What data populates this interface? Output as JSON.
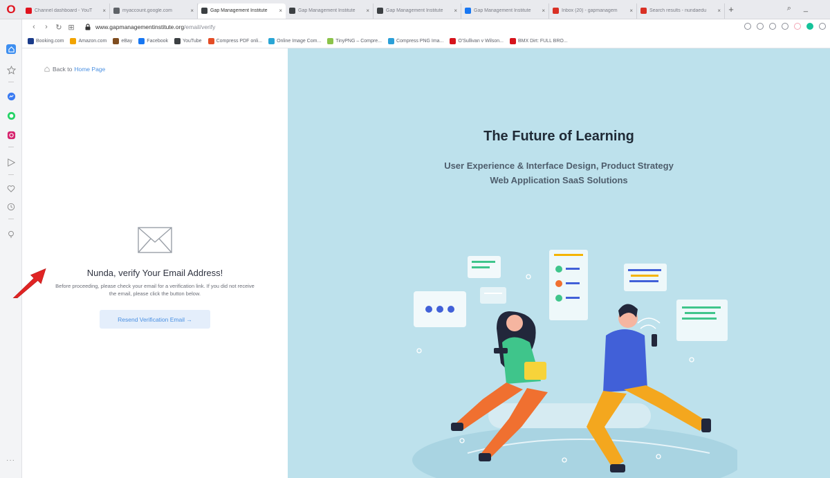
{
  "browser": {
    "tabs": [
      {
        "label": "Channel dashboard - YouT",
        "fav": "#e0131e",
        "active": false
      },
      {
        "label": "myaccount.google.com",
        "fav": "#5f6368",
        "active": false
      },
      {
        "label": "Gap Management Institute",
        "fav": "#3c4043",
        "active": true
      },
      {
        "label": "Gap Management Institute",
        "fav": "#3c4043",
        "active": false
      },
      {
        "label": "Gap Management Institute",
        "fav": "#3c4043",
        "active": false
      },
      {
        "label": "Gap Management Institute",
        "fav": "#1877f2",
        "active": false
      },
      {
        "label": "Inbox (20) - gapmanagem",
        "fav": "#d93025",
        "active": false
      },
      {
        "label": "Search results - nundaedu",
        "fav": "#d93025",
        "active": false
      }
    ],
    "address": {
      "host": "www.gapmanagementinstitute.org",
      "path": "/email/verify"
    },
    "bookmarks": [
      {
        "label": "Booking.com",
        "fav": "#1a3b8a"
      },
      {
        "label": "Amazon.com",
        "fav": "#f2a400"
      },
      {
        "label": "eBay",
        "fav": "#7f4d1f"
      },
      {
        "label": "Facebook",
        "fav": "#1877f2"
      },
      {
        "label": "YouTube",
        "fav": "#3c4043"
      },
      {
        "label": "Compress PDF onli...",
        "fav": "#e44d26"
      },
      {
        "label": "Online Image Com...",
        "fav": "#2aa6d5"
      },
      {
        "label": "TinyPNG – Compre...",
        "fav": "#8bc34a"
      },
      {
        "label": "Compress PNG Ima...",
        "fav": "#2b9fd8"
      },
      {
        "label": "O'Sullivan v Wilson...",
        "fav": "#d6141c"
      },
      {
        "label": "BMX Dirt: FULL BRO...",
        "fav": "#d6141c"
      }
    ]
  },
  "page": {
    "back_prefix": "Back to",
    "back_link": "Home Page",
    "title": "Nunda, verify Your Email Address!",
    "message": "Before proceeding, please check your email for a verification link. If you did not receive the email, please click the button below.",
    "resend_button": "Resend Verification Email →"
  },
  "hero": {
    "title": "The Future of Learning",
    "subtitle_line1": "User Experience & Interface Design, Product Strategy",
    "subtitle_line2": "Web Application SaaS Solutions"
  },
  "colors": {
    "accent": "#4a90e2",
    "hero_bg": "#bde1ec",
    "arrow": "#e02424"
  }
}
